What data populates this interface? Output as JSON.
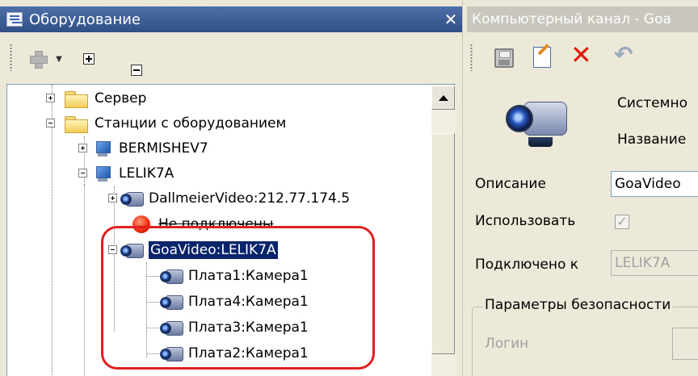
{
  "left_panel": {
    "title": "Оборудование",
    "close_symbol": "✕",
    "toolbar": {
      "add_icon": "plus-icon",
      "dropdown_symbol": "▼",
      "expand_all_icon": "plus-box-icon",
      "collapse_all_icon": "minus-box-icon"
    },
    "tree": {
      "server": "Сервер",
      "stations": "Станции с оборудованием",
      "bermishev": "BERMISHEV7",
      "lelik": "LELIK7A",
      "dallmeier": "DallmeierVideo:212.77.174.5",
      "not_connected": "Не подключены",
      "goavideo": "GoaVideo:LELIK7A",
      "cam1": "Плата1:Камера1",
      "cam4": "Плата4:Камера1",
      "cam3": "Плата3:Камера1",
      "cam2": "Плата2:Камера1"
    },
    "highlight_color": "#e02020",
    "selection_color": "#0a246a"
  },
  "right_panel": {
    "title": "Компьютерный канал - Goa",
    "toolbar": {
      "save_icon": "floppy-icon",
      "edit_icon": "edit-icon",
      "delete_symbol": "✕",
      "undo_symbol": "↶"
    },
    "system_label": "Системно",
    "name_label": "Название",
    "description_label": "Описание",
    "description_value": "GoaVideo",
    "use_label": "Использовать",
    "use_checked": "✓",
    "connected_label": "Подключено к",
    "connected_value": "LELIK7A",
    "security_group_title": "Параметры безопасности",
    "login_label": "Логин"
  }
}
